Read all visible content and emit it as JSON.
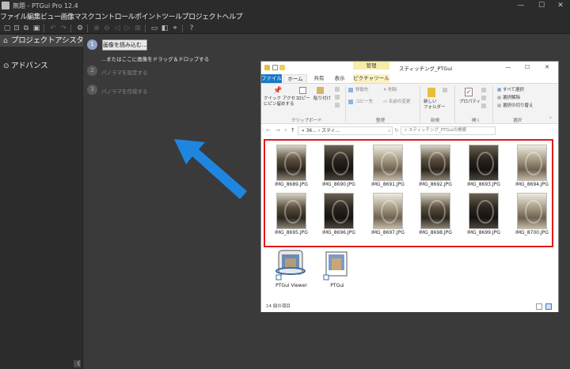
{
  "window": {
    "title": "無題 - PTGui Pro 12.4",
    "minimize": "—",
    "maximize": "☐",
    "close": "✕"
  },
  "menu": [
    "ファイル",
    "編集",
    "ビュー",
    "画像",
    "マスク",
    "コントロールポイント",
    "ツール",
    "プロジェクト",
    "ヘルプ"
  ],
  "sidebar": {
    "items": [
      {
        "label": "プロジェクトアシスタント",
        "icon": "home-icon",
        "active": true
      },
      {
        "label": "アドバンス",
        "icon": "circle-chevron-icon",
        "active": false
      }
    ],
    "collapse_glyph": "《"
  },
  "steps": [
    {
      "number": "1",
      "button": "画像を読み込む...",
      "hint": "...またはここに画像をドラッグ＆ドロップする"
    },
    {
      "number": "2",
      "label": "パノラマを設定する"
    },
    {
      "number": "3",
      "label": "パノラマを作成する"
    }
  ],
  "explorer": {
    "manage_tab": "管理",
    "title": "スティッチング_PTGui",
    "tabs": [
      "ファイル",
      "ホーム",
      "共有",
      "表示",
      "ピクチャツール"
    ],
    "ribbon": {
      "pin_label": "クイック アクセス\nにピン留めする",
      "copy_label": "コピー",
      "paste_label": "貼り付け",
      "clipboard_group": "クリップボード",
      "move_label": "移動先",
      "copy_to_label": "コピー先",
      "delete_label": "削除",
      "rename_label": "名前の変更",
      "organize_group": "整理",
      "new_folder_label": "新しい\nフォルダー",
      "new_group": "新規",
      "properties_label": "プロパティ",
      "open_group": "開く",
      "select_all": "すべて選択",
      "select_none": "選択解除",
      "invert_selection": "選択の切り替え",
      "select_group": "選択"
    },
    "address": "« 36...  ›  スティ...",
    "search_placeholder": "スティッチング_PTGuiの検索",
    "files": [
      {
        "name": "IMG_8689.JPG",
        "tone": "mid"
      },
      {
        "name": "IMG_8690.JPG",
        "tone": "dark"
      },
      {
        "name": "IMG_8691.JPG",
        "tone": "light"
      },
      {
        "name": "IMG_8692.JPG",
        "tone": "mid"
      },
      {
        "name": "IMG_8693.JPG",
        "tone": "dark"
      },
      {
        "name": "IMG_8694.JPG",
        "tone": "light"
      },
      {
        "name": "IMG_8695.JPG",
        "tone": "mid"
      },
      {
        "name": "IMG_8696.JPG",
        "tone": "dark"
      },
      {
        "name": "IMG_8697.JPG",
        "tone": "light"
      },
      {
        "name": "IMG_8698.JPG",
        "tone": "mid"
      },
      {
        "name": "IMG_8699.JPG",
        "tone": "dark"
      },
      {
        "name": "IMG_8700.JPG",
        "tone": "light"
      }
    ],
    "shortcuts": [
      "PTGui Viewer",
      "PTGui"
    ],
    "status": "14 個の項目"
  },
  "colors": {
    "highlight_box": "#e21a1a",
    "arrow": "#1f86e0",
    "file_tab": "#1979ca"
  }
}
